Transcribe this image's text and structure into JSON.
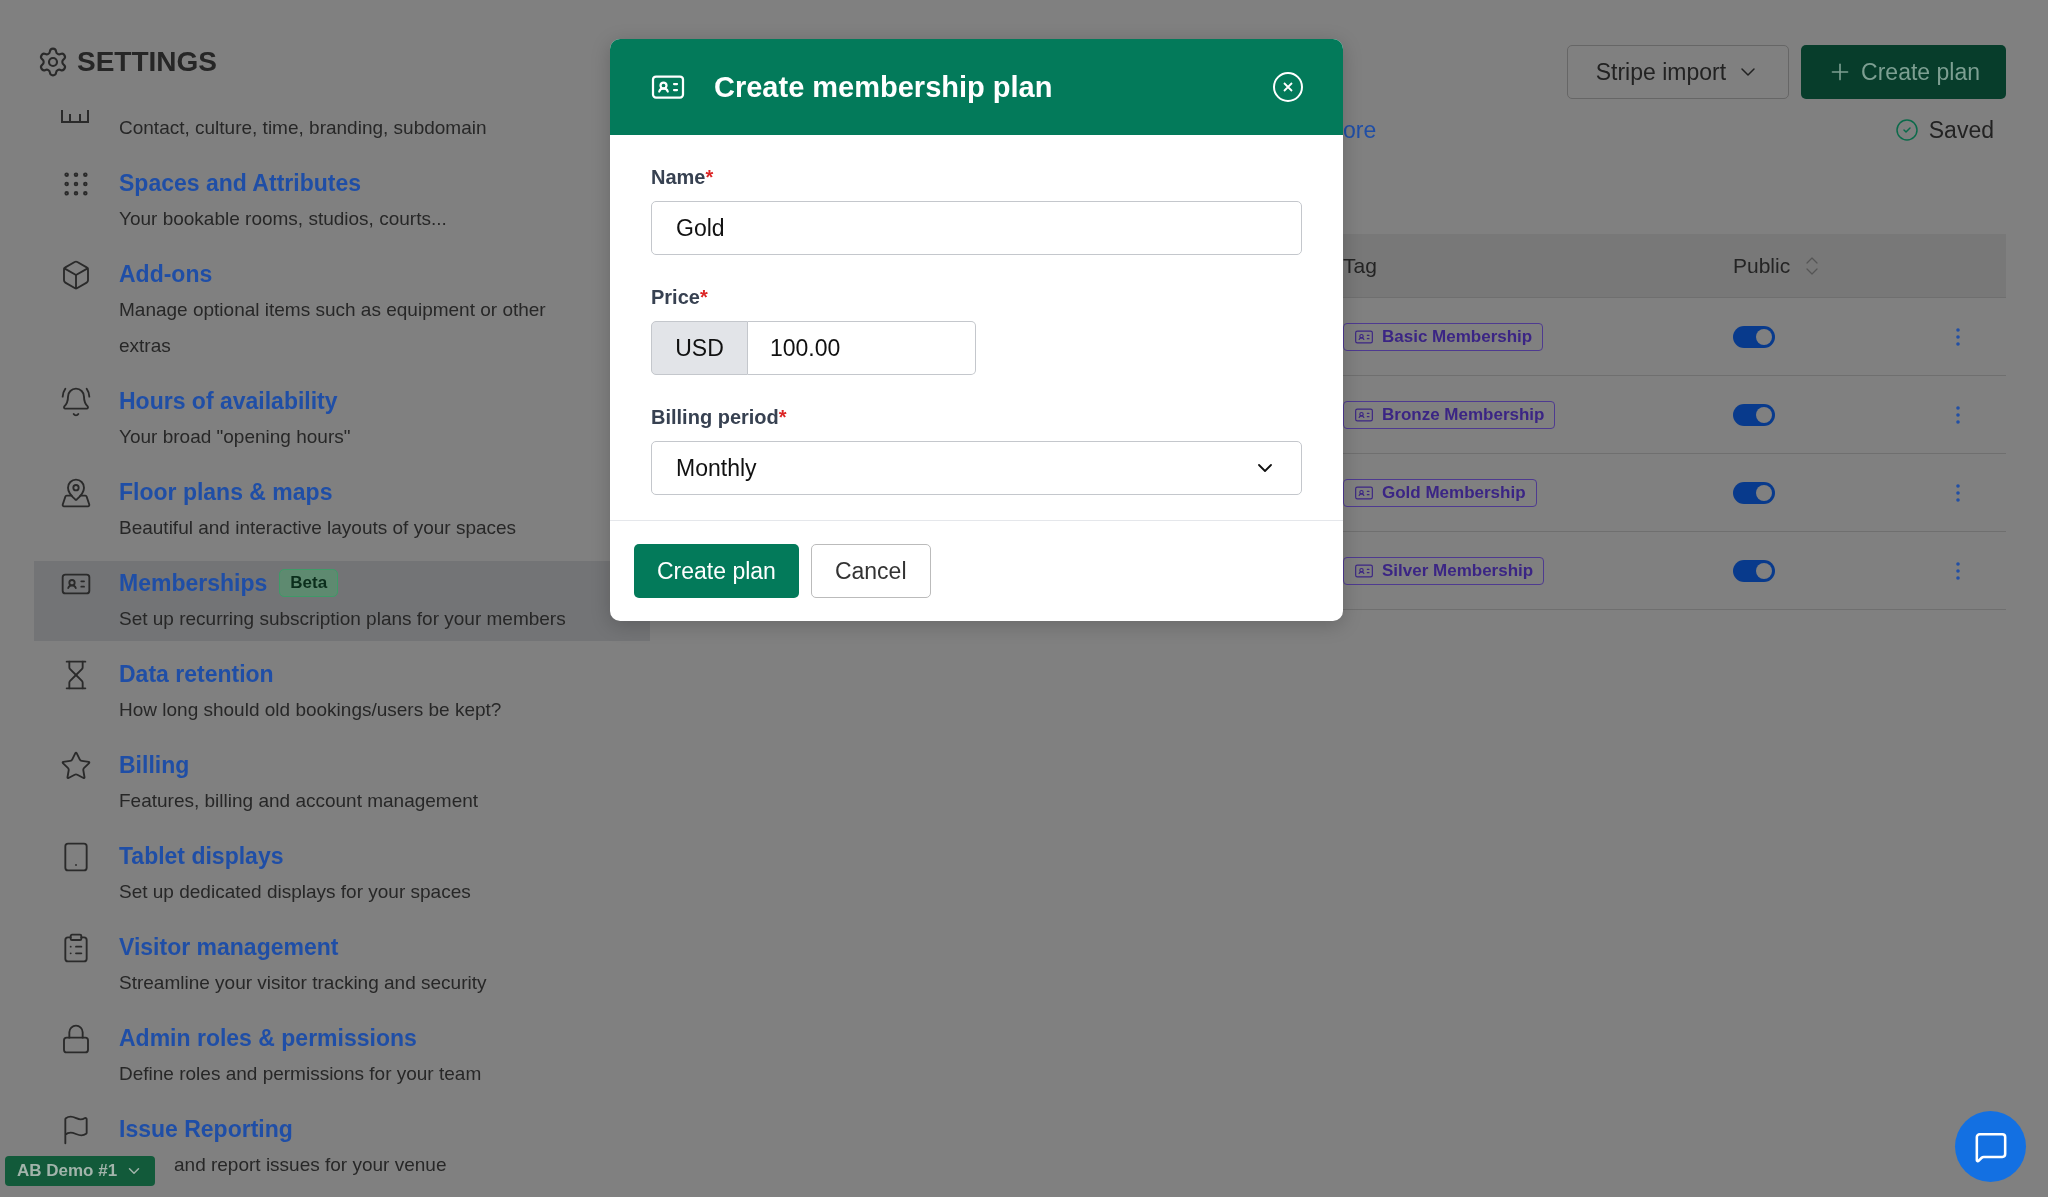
{
  "settings_title": "SETTINGS",
  "sidebar": {
    "items": [
      {
        "description": "Contact, culture, time, branding, subdomain",
        "selected": false
      },
      {
        "title": "Spaces and Attributes",
        "description": "Your bookable rooms, studios, courts...",
        "selected": false
      },
      {
        "title": "Add-ons",
        "description": "Manage optional items such as equipment or other extras",
        "selected": false
      },
      {
        "title": "Hours of availability",
        "description": "Your broad \"opening hours\"",
        "selected": false
      },
      {
        "title": "Floor plans & maps",
        "description": "Beautiful and interactive layouts of your spaces",
        "selected": false
      },
      {
        "title": "Memberships",
        "badge": "Beta",
        "description": "Set up recurring subscription plans for your members",
        "selected": true
      },
      {
        "title": "Data retention",
        "description": "How long should old bookings/users be kept?",
        "selected": false
      },
      {
        "title": "Billing",
        "description": "Features, billing and account management",
        "selected": false
      },
      {
        "title": "Tablet displays",
        "description": "Set up dedicated displays for your spaces",
        "selected": false
      },
      {
        "title": "Visitor management",
        "description": "Streamline your visitor tracking and security",
        "selected": false
      },
      {
        "title": "Admin roles & permissions",
        "description": "Define roles and permissions for your team",
        "selected": false
      },
      {
        "title": "Issue Reporting",
        "description": "and report issues for your venue",
        "selected": false
      }
    ]
  },
  "account_switcher": "AB Demo #1",
  "toolbar": {
    "import_button": "Stripe import",
    "create_button": "Create plan"
  },
  "learn_more_link": "ore",
  "save_status": "Saved",
  "table": {
    "columns": [
      "Tag",
      "Public"
    ],
    "rows": [
      {
        "tag": "Basic Membership",
        "public": true
      },
      {
        "tag": "Bronze Membership",
        "public": true
      },
      {
        "tag": "Gold Membership",
        "public": true
      },
      {
        "tag": "Silver Membership",
        "public": true
      }
    ]
  },
  "modal": {
    "title": "Create membership plan",
    "fields": [
      {
        "kind": "text",
        "label": "Name",
        "required_mark": "*",
        "value": "Gold"
      },
      {
        "kind": "price",
        "label": "Price",
        "required_mark": "*",
        "currency": "USD",
        "value": "100.00"
      },
      {
        "kind": "select",
        "label": "Billing period",
        "required_mark": "*",
        "value": "Monthly"
      }
    ],
    "buttons": [
      {
        "kind": "primary",
        "label": "Create plan"
      },
      {
        "kind": "secondary",
        "label": "Cancel"
      }
    ]
  }
}
